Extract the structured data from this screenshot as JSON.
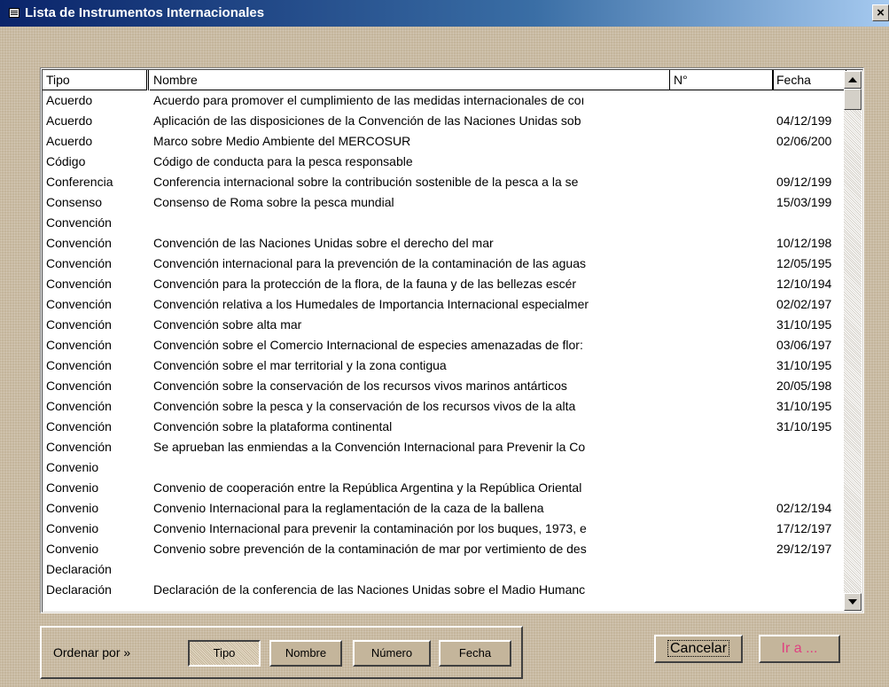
{
  "window": {
    "title": "Lista de Instrumentos Internacionales",
    "close_label": "×"
  },
  "columns": [
    "Tipo",
    "Nombre",
    "N°",
    "Fecha"
  ],
  "rows": [
    [
      "Acuerdo",
      "Acuerdo para promover el cumplimiento de las medidas internacionales de coı",
      "",
      ""
    ],
    [
      "Acuerdo",
      "Aplicación de las disposiciones de la Convención de las Naciones Unidas sob",
      "",
      "04/12/199"
    ],
    [
      "Acuerdo",
      "Marco sobre Medio Ambiente del MERCOSUR",
      "",
      "02/06/200"
    ],
    [
      "Código",
      "Código de conducta para la pesca responsable",
      "",
      ""
    ],
    [
      "Conferencia",
      "Conferencia internacional sobre la contribución sostenible de la pesca a la se",
      "",
      "09/12/199"
    ],
    [
      "Consenso",
      "Consenso de Roma sobre la pesca mundial",
      "",
      "15/03/199"
    ],
    [
      "Convención",
      "",
      "",
      ""
    ],
    [
      "Convención",
      "Convención de las Naciones Unidas sobre el derecho del mar",
      "",
      "10/12/198"
    ],
    [
      "Convención",
      "Convención internacional para la prevención de la contaminación de las aguas",
      "",
      "12/05/195"
    ],
    [
      "Convención",
      "Convención para la protección de la flora, de la fauna y de las bellezas escér",
      "",
      "12/10/194"
    ],
    [
      "Convención",
      "Convención relativa a los Humedales de Importancia Internacional especialmer",
      "",
      "02/02/197"
    ],
    [
      "Convención",
      "Convención sobre alta mar",
      "",
      "31/10/195"
    ],
    [
      "Convención",
      "Convención sobre el Comercio Internacional de especies amenazadas de flor:",
      "",
      "03/06/197"
    ],
    [
      "Convención",
      "Convención sobre el mar territorial y la zona contigua",
      "",
      "31/10/195"
    ],
    [
      "Convención",
      "Convención sobre la conservación de los recursos vivos marinos antárticos",
      "",
      "20/05/198"
    ],
    [
      "Convención",
      "Convención sobre la pesca y la conservación de los recursos vivos de la alta",
      "",
      "31/10/195"
    ],
    [
      "Convención",
      "Convención sobre la plataforma continental",
      "",
      "31/10/195"
    ],
    [
      "Convención",
      "Se aprueban las enmiendas a la Convención Internacional para Prevenir la Co",
      "",
      ""
    ],
    [
      "Convenio",
      "",
      "",
      ""
    ],
    [
      "Convenio",
      "Convenio de cooperación entre la República Argentina y la República Oriental",
      "",
      ""
    ],
    [
      "Convenio",
      "Convenio Internacional para la reglamentación de la caza de la ballena",
      "",
      "02/12/194"
    ],
    [
      "Convenio",
      "Convenio Internacional para prevenir la contaminación por los buques, 1973, e",
      "",
      "17/12/197"
    ],
    [
      "Convenio",
      "Convenio sobre prevención de la contaminación de mar por vertimiento de des",
      "",
      "29/12/197"
    ],
    [
      "Declaración",
      "",
      "",
      ""
    ],
    [
      "Declaración",
      "Declaración de la conferencia de las Naciones Unidas sobre el Madio Humanc",
      "",
      ""
    ]
  ],
  "sort": {
    "label": "Ordenar por »",
    "buttons": [
      "Tipo",
      "Nombre",
      "Número",
      "Fecha"
    ],
    "selected": "Tipo"
  },
  "actions": {
    "cancel": "Cancelar",
    "goto": "Ir a ..."
  }
}
